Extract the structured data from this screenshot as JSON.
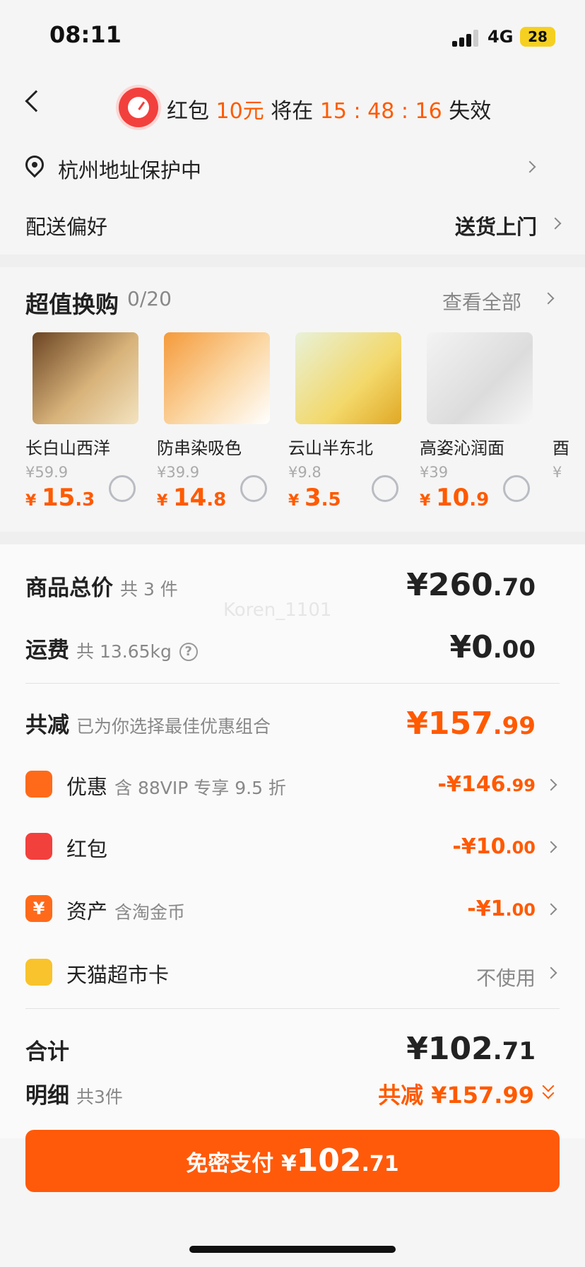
{
  "status": {
    "time": "08:11",
    "network": "4G",
    "battery": "28"
  },
  "header": {
    "prefix": "红包 ",
    "amount": "10元",
    "middle": " 将在 ",
    "countdown": "15 : 48 : 16",
    "suffix": " 失效"
  },
  "address": {
    "text": "杭州地址保护中"
  },
  "delivery": {
    "label": "配送偏好",
    "value": "送货上门"
  },
  "exchange": {
    "title": "超值换购",
    "count": "0/20",
    "see_all": "查看全部",
    "items": [
      {
        "name": "长白山西洋",
        "orig": "¥59.9",
        "int": "15",
        "dec": ".3"
      },
      {
        "name": "防串染吸色",
        "orig": "¥39.9",
        "int": "14",
        "dec": ".8"
      },
      {
        "name": "云山半东北",
        "orig": "¥9.8",
        "int": "3",
        "dec": ".5"
      },
      {
        "name": "高姿沁润面",
        "orig": "¥39",
        "int": "10",
        "dec": ".9"
      },
      {
        "name": "酉",
        "orig": "¥",
        "int": "",
        "dec": ""
      }
    ]
  },
  "summary": {
    "goods_label": "商品总价",
    "goods_count": "共 3 件",
    "goods_int": "¥260",
    "goods_dec": ".70",
    "ship_label": "运费",
    "ship_weight": "共 13.65kg",
    "ship_int": "¥0",
    "ship_dec": ".00",
    "reduce_label": "共减",
    "reduce_note": "已为你选择最佳优惠组合",
    "reduce_int": "¥157",
    "reduce_dec": ".99",
    "discount_label": "优惠",
    "discount_note": "含 88VIP 专享 9.5 折",
    "discount_int": "-¥146",
    "discount_dec": ".99",
    "redpacket_label": "红包",
    "redpacket_int": "-¥10",
    "redpacket_dec": ".00",
    "asset_label": "资产",
    "asset_note": "含淘金币",
    "asset_int": "-¥1",
    "asset_dec": ".00",
    "card_label": "天猫超市卡",
    "card_value": "不使用",
    "total_label": "合计",
    "total_int": "¥102",
    "total_dec": ".71",
    "detail_label": "明细",
    "detail_count": "共3件",
    "detail_reduce": "共减 ¥157.99"
  },
  "pay": {
    "label": "免密支付 ¥",
    "int": "102",
    "dec": ".71"
  },
  "watermark": "Koren_1101",
  "colors": {
    "accent": "#ff5a00",
    "button": "#ff5a0a"
  }
}
